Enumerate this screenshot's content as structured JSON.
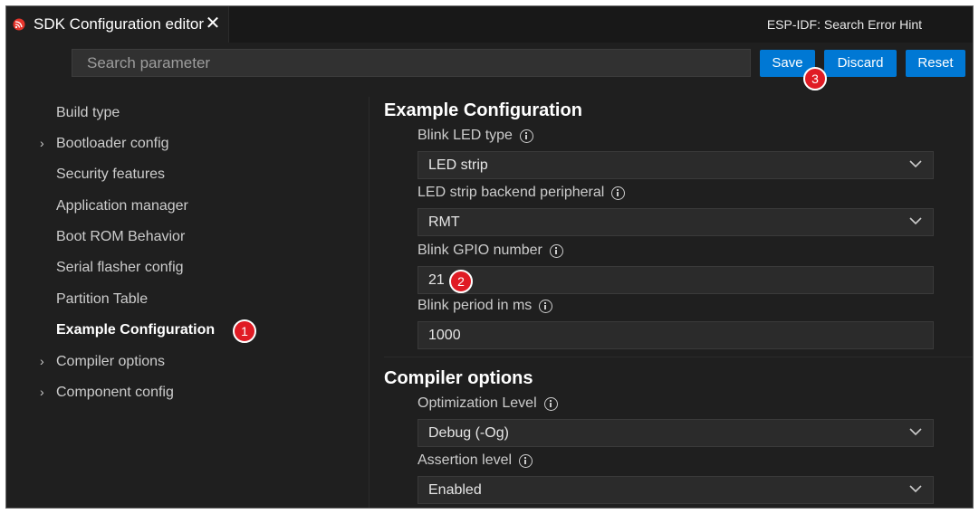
{
  "tab": {
    "title": "SDK Configuration editor",
    "close": "✕",
    "right_label": "ESP-IDF: Search Error Hint"
  },
  "search": {
    "placeholder": "Search parameter"
  },
  "toolbar": {
    "save": "Save",
    "discard": "Discard",
    "reset": "Reset"
  },
  "badges": {
    "one": "1",
    "two": "2",
    "three": "3"
  },
  "sidebar": {
    "items": [
      {
        "label": "Build type",
        "expandable": false
      },
      {
        "label": "Bootloader config",
        "expandable": true
      },
      {
        "label": "Security features",
        "expandable": false
      },
      {
        "label": "Application manager",
        "expandable": false
      },
      {
        "label": "Boot ROM Behavior",
        "expandable": false
      },
      {
        "label": "Serial flasher config",
        "expandable": false
      },
      {
        "label": "Partition Table",
        "expandable": false
      },
      {
        "label": "Example Configuration",
        "expandable": false,
        "active": true
      },
      {
        "label": "Compiler options",
        "expandable": true
      },
      {
        "label": "Component config",
        "expandable": true
      }
    ]
  },
  "main": {
    "example": {
      "title": "Example Configuration",
      "blink_led_type": {
        "label": "Blink LED type",
        "value": "LED strip"
      },
      "led_strip_backend": {
        "label": "LED strip backend peripheral",
        "value": "RMT"
      },
      "blink_gpio": {
        "label": "Blink GPIO number",
        "value": "21"
      },
      "blink_period": {
        "label": "Blink period in ms",
        "value": "1000"
      }
    },
    "compiler": {
      "title": "Compiler options",
      "optimization": {
        "label": "Optimization Level",
        "value": "Debug (-Og)"
      },
      "assertion": {
        "label": "Assertion level",
        "value": "Enabled"
      }
    }
  },
  "colors": {
    "accent": "#0078d4",
    "badge": "#e01b24",
    "background": "#1f1f1f",
    "brand_icon": "#e7352c"
  },
  "icons": {
    "tab": "espressif-logo-icon",
    "info": "info-icon",
    "dropdown": "chevron-down-icon",
    "expand": "chevron-right-icon"
  }
}
